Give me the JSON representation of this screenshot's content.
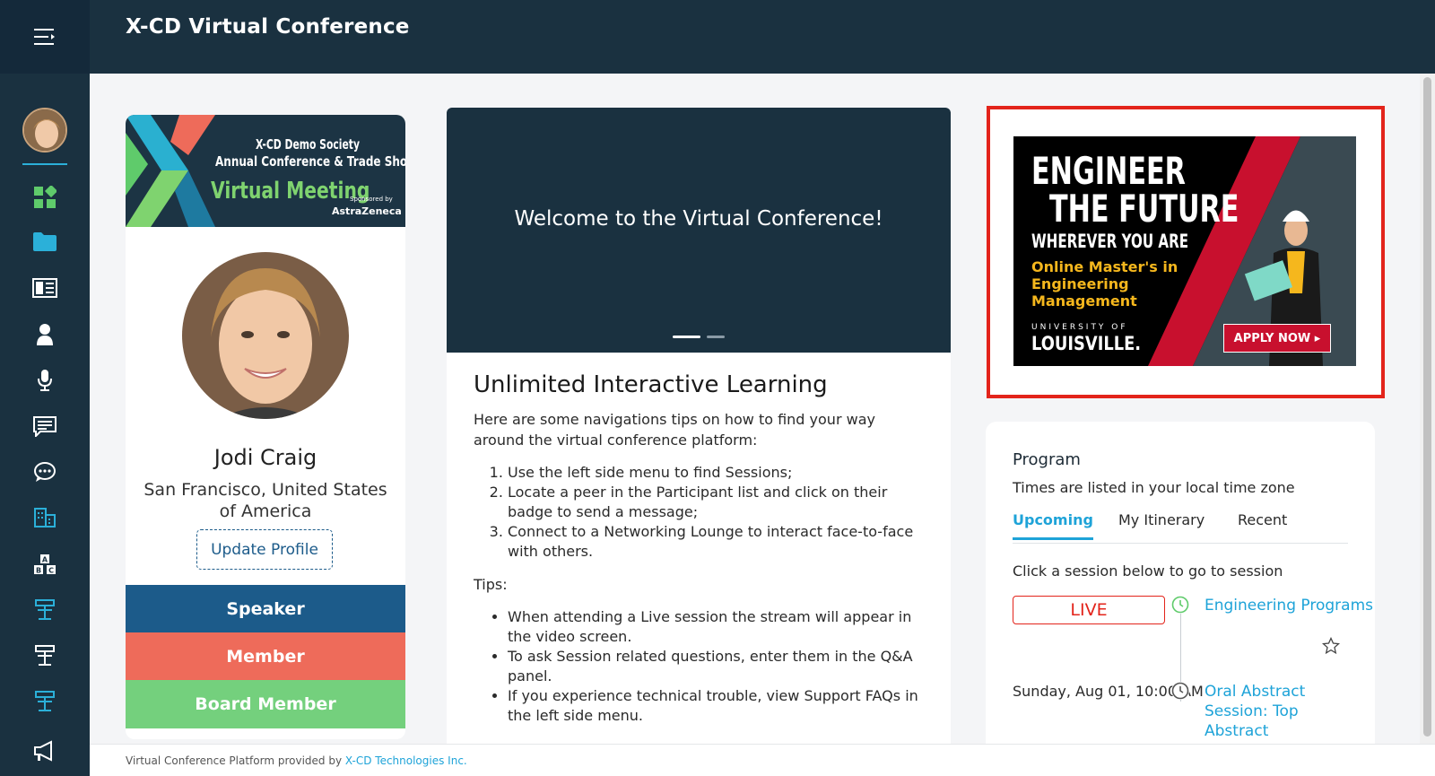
{
  "app": {
    "title": "X-CD Virtual Conference"
  },
  "profile": {
    "banner": {
      "line1": "X-CD Demo Society",
      "line2": "Annual Conference & Trade Show",
      "line3": "Virtual Meeting",
      "sponsor_label": "Sponsored by",
      "sponsor": "AstraZeneca"
    },
    "name": "Jodi Craig",
    "location": "San Francisco, United States of America",
    "update_label": "Update Profile",
    "roles": [
      "Speaker",
      "Member",
      "Board Member"
    ]
  },
  "welcome": {
    "hero_title": "Welcome to the Virtual Conference!",
    "heading": "Unlimited Interactive Learning",
    "intro": "Here are some navigations tips on how to find your way around the virtual conference platform:",
    "steps": [
      "Use the left side menu to find Sessions;",
      "Locate a peer in the Participant list and click on their badge to send a message;",
      "Connect to a Networking Lounge to interact face-to-face with others."
    ],
    "tips_label": "Tips:",
    "tips": [
      "When attending a Live session the stream will appear in the video screen.",
      "To ask Session related questions, enter them in the Q&A panel.",
      "If you experience technical trouble, view Support FAQs in the left side menu."
    ]
  },
  "ad": {
    "line1": "ENGINEER",
    "line2": "THE FUTURE",
    "line3": "WHEREVER YOU ARE",
    "line4": "Online Master's in Engineering Management",
    "line5": "UNIVERSITY OF",
    "line6": "LOUISVILLE.",
    "cta": "APPLY NOW ▸",
    "colors": {
      "accent": "#f5b71d",
      "cta": "#c8102e",
      "frame": "#e3241b"
    }
  },
  "program": {
    "title": "Program",
    "subtitle": "Times are listed in your local time zone",
    "tabs": [
      "Upcoming",
      "My Itinerary",
      "Recent"
    ],
    "active_tab": "Upcoming",
    "hint": "Click a session below to go to session",
    "sessions": [
      {
        "badge": "LIVE",
        "title": "Engineering Programs"
      },
      {
        "date": "Sunday, Aug 01, 10:00 AM",
        "title": "Oral Abstract Session: Top Abstract"
      }
    ]
  },
  "footer": {
    "text": "Virtual Conference Platform provided by",
    "link": "X-CD Technologies Inc."
  },
  "colors": {
    "sidebar": "#1a3140",
    "accent": "#1ea3d8",
    "nav_icon": "#2bb0d9",
    "green_icon": "#5fcb6b"
  }
}
